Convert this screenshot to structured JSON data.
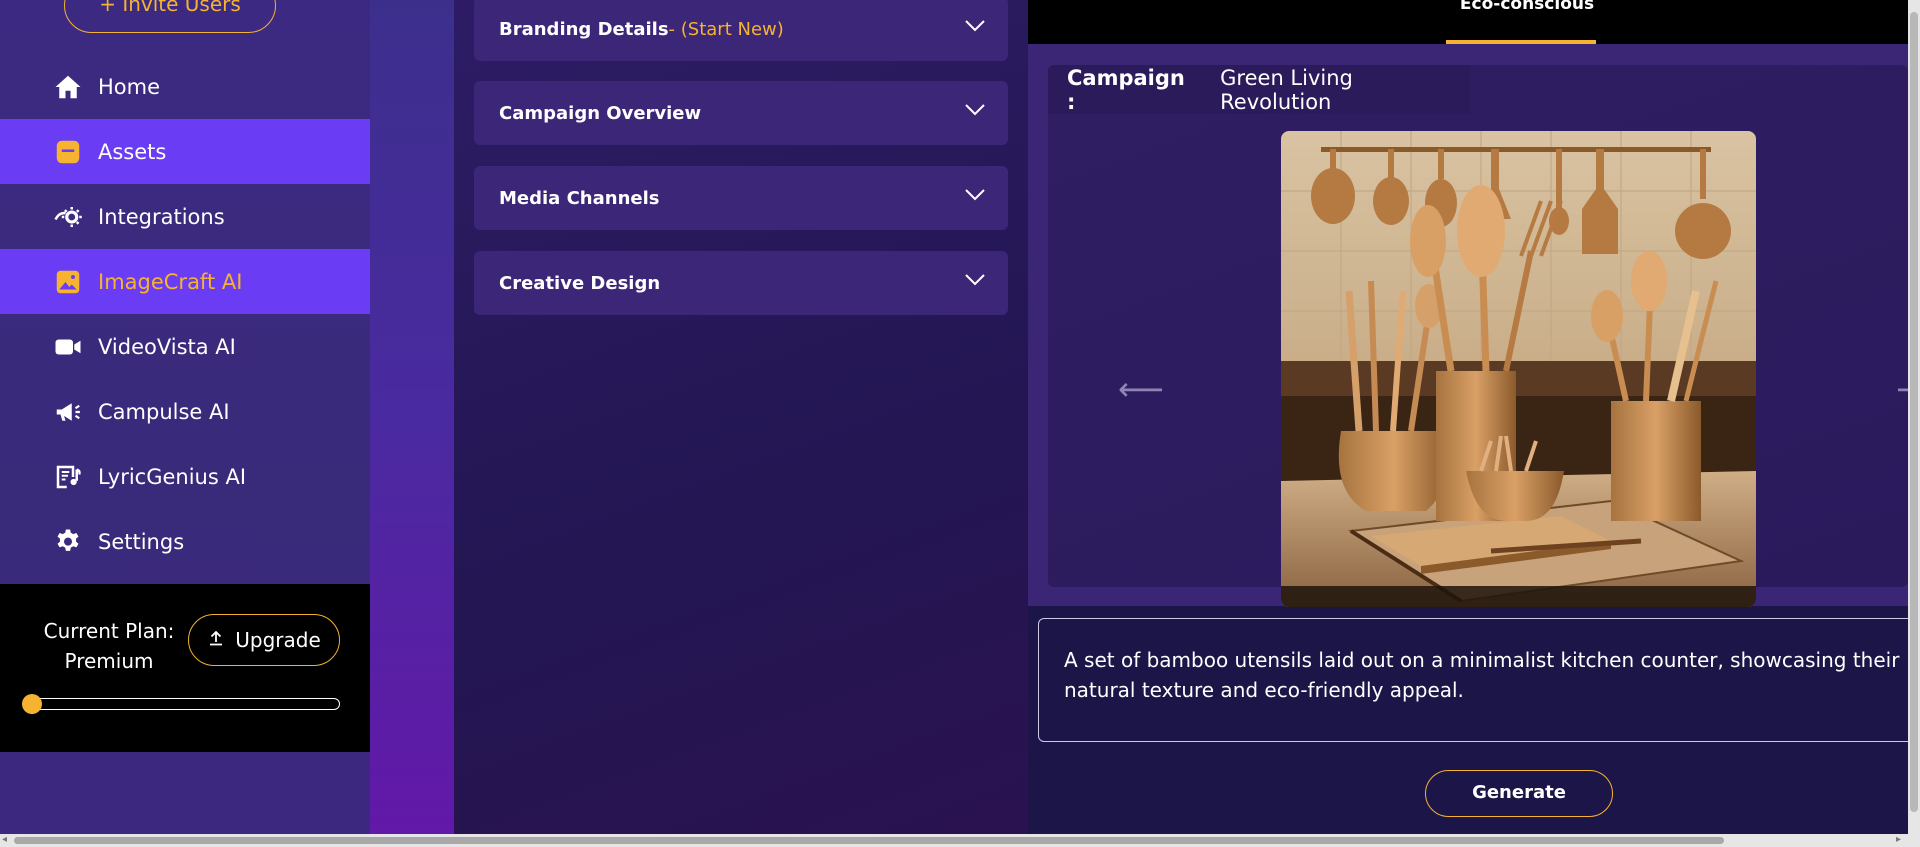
{
  "sidebar": {
    "invite_label": "+ Invite Users",
    "items": [
      {
        "label": "Home",
        "icon": "home-icon"
      },
      {
        "label": "Assets",
        "icon": "assets-icon"
      },
      {
        "label": "Integrations",
        "icon": "integrations-icon"
      },
      {
        "label": "ImageCraft AI",
        "icon": "image-icon"
      },
      {
        "label": "VideoVista AI",
        "icon": "video-camera-icon"
      },
      {
        "label": "Campulse AI",
        "icon": "megaphone-icon"
      },
      {
        "label": "LyricGenius AI",
        "icon": "lyrics-icon"
      },
      {
        "label": "Settings",
        "icon": "gear-icon"
      }
    ],
    "plan": {
      "label_line1": "Current Plan:",
      "label_line2": "Premium",
      "upgrade_label": "Upgrade",
      "usage_level": 0.0
    }
  },
  "accordion": {
    "sections": [
      {
        "title": "Branding Details",
        "suffix": " - (Start New)"
      },
      {
        "title": "Campaign Overview",
        "suffix": ""
      },
      {
        "title": "Media Channels",
        "suffix": ""
      },
      {
        "title": "Creative Design",
        "suffix": ""
      }
    ]
  },
  "preview": {
    "active_tab": "Eco-conscious",
    "campaign_label": "Campaign :",
    "campaign_name": "Green Living Revolution",
    "prev_arrow": "⟵",
    "next_arrow": "⟶",
    "description": "A set of bamboo utensils laid out on a minimalist kitchen counter, showcasing their natural texture and eco-friendly appeal.",
    "generate_label": "Generate"
  },
  "colors": {
    "accent": "#f5b331",
    "active_nav": "#6a3cf3",
    "sidebar_bg": "#3c2a82",
    "panel_bg": "#1c1548"
  }
}
